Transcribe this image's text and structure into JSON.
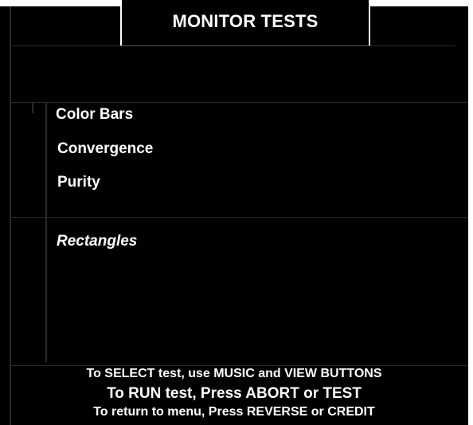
{
  "screen": {
    "title": "MONITOR TESTS",
    "background_color": "#000000",
    "text_color": "#ffffff"
  },
  "menu": {
    "items": [
      {
        "label": "Color Bars"
      },
      {
        "label": "Convergence"
      },
      {
        "label": "Purity"
      },
      {
        "label": "Rectangles"
      }
    ],
    "selected_label": "Rectangles"
  },
  "instructions": {
    "select": "To SELECT test, use MUSIC and VIEW BUTTONS",
    "run": "To RUN test, Press ABORT or TEST",
    "return": "To return to menu, Press REVERSE or CREDIT"
  }
}
